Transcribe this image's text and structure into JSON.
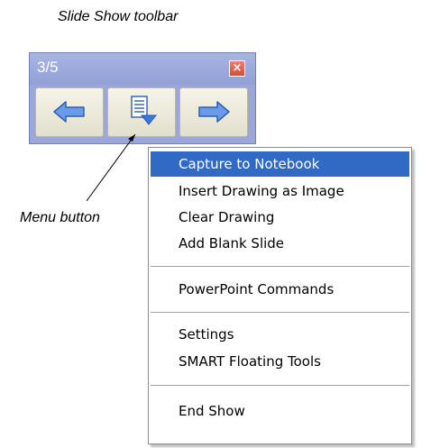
{
  "captions": {
    "toolbar": "Slide Show toolbar",
    "menu_button": "Menu button"
  },
  "toolbar": {
    "counter": "3/5",
    "close_label": "×",
    "buttons": [
      {
        "name": "previous",
        "icon": "left-arrow-icon"
      },
      {
        "name": "menu",
        "icon": "menu-icon"
      },
      {
        "name": "next",
        "icon": "right-arrow-icon"
      }
    ],
    "colors": {
      "titlebar": "#9aa7d8",
      "close": "#d84b35",
      "arrow": "#5a8fe0"
    }
  },
  "menu": {
    "items": [
      {
        "label": "Capture to Notebook",
        "highlighted": true
      },
      {
        "label": "Insert Drawing as Image"
      },
      {
        "label": "Clear Drawing"
      },
      {
        "label": "Add Blank Slide"
      },
      {
        "label": "PowerPoint Commands"
      },
      {
        "label": "Settings"
      },
      {
        "label": "SMART Floating Tools"
      },
      {
        "label": "End Show"
      }
    ],
    "highlight_color": "#316ac5"
  }
}
